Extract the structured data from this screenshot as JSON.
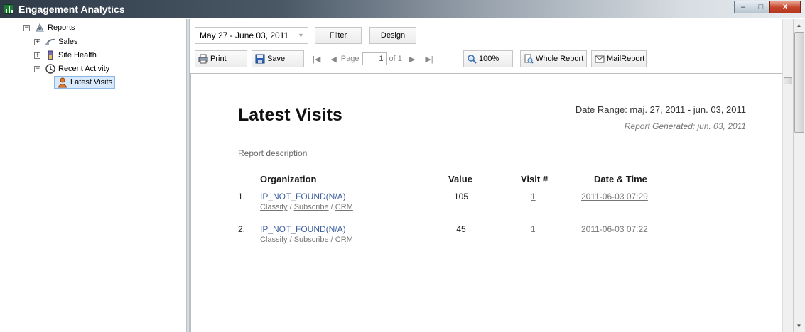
{
  "window": {
    "title": "Engagement Analytics",
    "controls": {
      "minimize": "–",
      "maximize": "□",
      "close": "X"
    }
  },
  "tree": {
    "root": {
      "label": "Reports",
      "expander": "−"
    },
    "items": [
      {
        "label": "Sales",
        "expander": "+"
      },
      {
        "label": "Site Health",
        "expander": "+"
      },
      {
        "label": "Recent Activity",
        "expander": "−"
      }
    ],
    "selected": {
      "label": "Latest Visits"
    }
  },
  "toolbar": {
    "date_range_value": "May 27 - June 03, 2011",
    "filter_label": "Filter",
    "design_label": "Design",
    "print_label": "Print",
    "save_label": "Save",
    "page_label": "Page",
    "page_value": "1",
    "page_of": "of 1",
    "zoom_label": "100%",
    "whole_report_label": "Whole Report",
    "mail_report_label": "MailReport"
  },
  "report": {
    "title": "Latest Visits",
    "date_range": "Date Range: maj. 27, 2011 - jun. 03, 2011",
    "generated": "Report Generated: jun. 03, 2011",
    "description_link": "Report description",
    "columns": {
      "organization": "Organization",
      "value": "Value",
      "visit": "Visit #",
      "datetime": "Date & Time"
    },
    "rows": [
      {
        "num": "1.",
        "org": "IP_NOT_FOUND(N/A)",
        "classify": "Classify",
        "subscribe": "Subscribe",
        "crm": "CRM",
        "value": "105",
        "visit": "1",
        "datetime": "2011-06-03 07:29"
      },
      {
        "num": "2.",
        "org": "IP_NOT_FOUND(N/A)",
        "classify": "Classify",
        "subscribe": "Subscribe",
        "crm": "CRM",
        "value": "45",
        "visit": "1",
        "datetime": "2011-06-03 07:22"
      }
    ],
    "separator": " / "
  },
  "colors": {
    "link_blue": "#3d5f9e",
    "selection": "#d7e9fb",
    "close_red": "#c4432a"
  }
}
